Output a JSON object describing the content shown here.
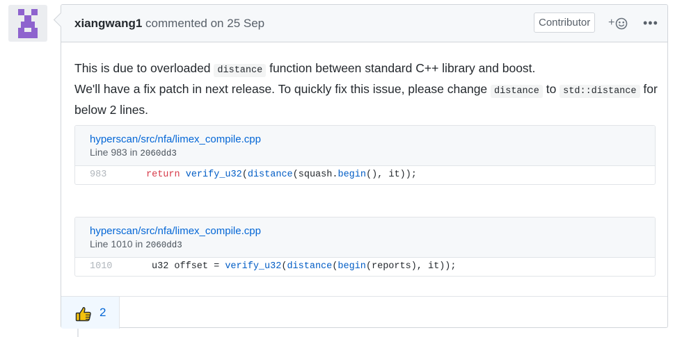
{
  "comment": {
    "author": "xiangwang1",
    "action": "commented on",
    "date": "25 Sep",
    "badge": "Contributor",
    "add_reaction_symbol": "+",
    "more_symbol": "•••",
    "body": {
      "line1_pre": "This is due to overloaded ",
      "line1_code": "distance",
      "line1_post": " function between standard C++ library and boost.",
      "line2_pre": "We'll have a fix patch in next release. To quickly fix this issue, please change ",
      "line2_code1": "distance",
      "line2_mid": " to ",
      "line2_code2": "std::distance",
      "line2_post": " for",
      "line3": "below 2 lines."
    },
    "snippets": [
      {
        "path": "hyperscan/src/nfa/limex_compile.cpp",
        "line_label": "Line 983 in ",
        "commit": "2060dd3",
        "line_number": "983",
        "code": {
          "kw": "return",
          "sp1": " ",
          "fn1": "verify_u32",
          "p1": "(",
          "fn2": "distance",
          "p2": "(squash.",
          "fn3": "begin",
          "p3": "(), it));"
        }
      },
      {
        "path": "hyperscan/src/nfa/limex_compile.cpp",
        "line_label": "Line 1010 in ",
        "commit": "2060dd3",
        "line_number": "1010",
        "code": {
          "t1": "u32 offset = ",
          "fn1": "verify_u32",
          "p1": "(",
          "fn2": "distance",
          "p2": "(",
          "fn3": "begin",
          "p3": "(reports), it));"
        }
      }
    ],
    "reactions": [
      {
        "emoji": "thumbs-up-icon",
        "count": "2"
      }
    ]
  },
  "colors": {
    "link": "#0366d6",
    "keyword": "#d73a49",
    "function": "#005cc5",
    "header_bg": "#f6f8fa",
    "reaction_bg": "#f1f8ff",
    "avatar_purple": "#8e63ce"
  }
}
